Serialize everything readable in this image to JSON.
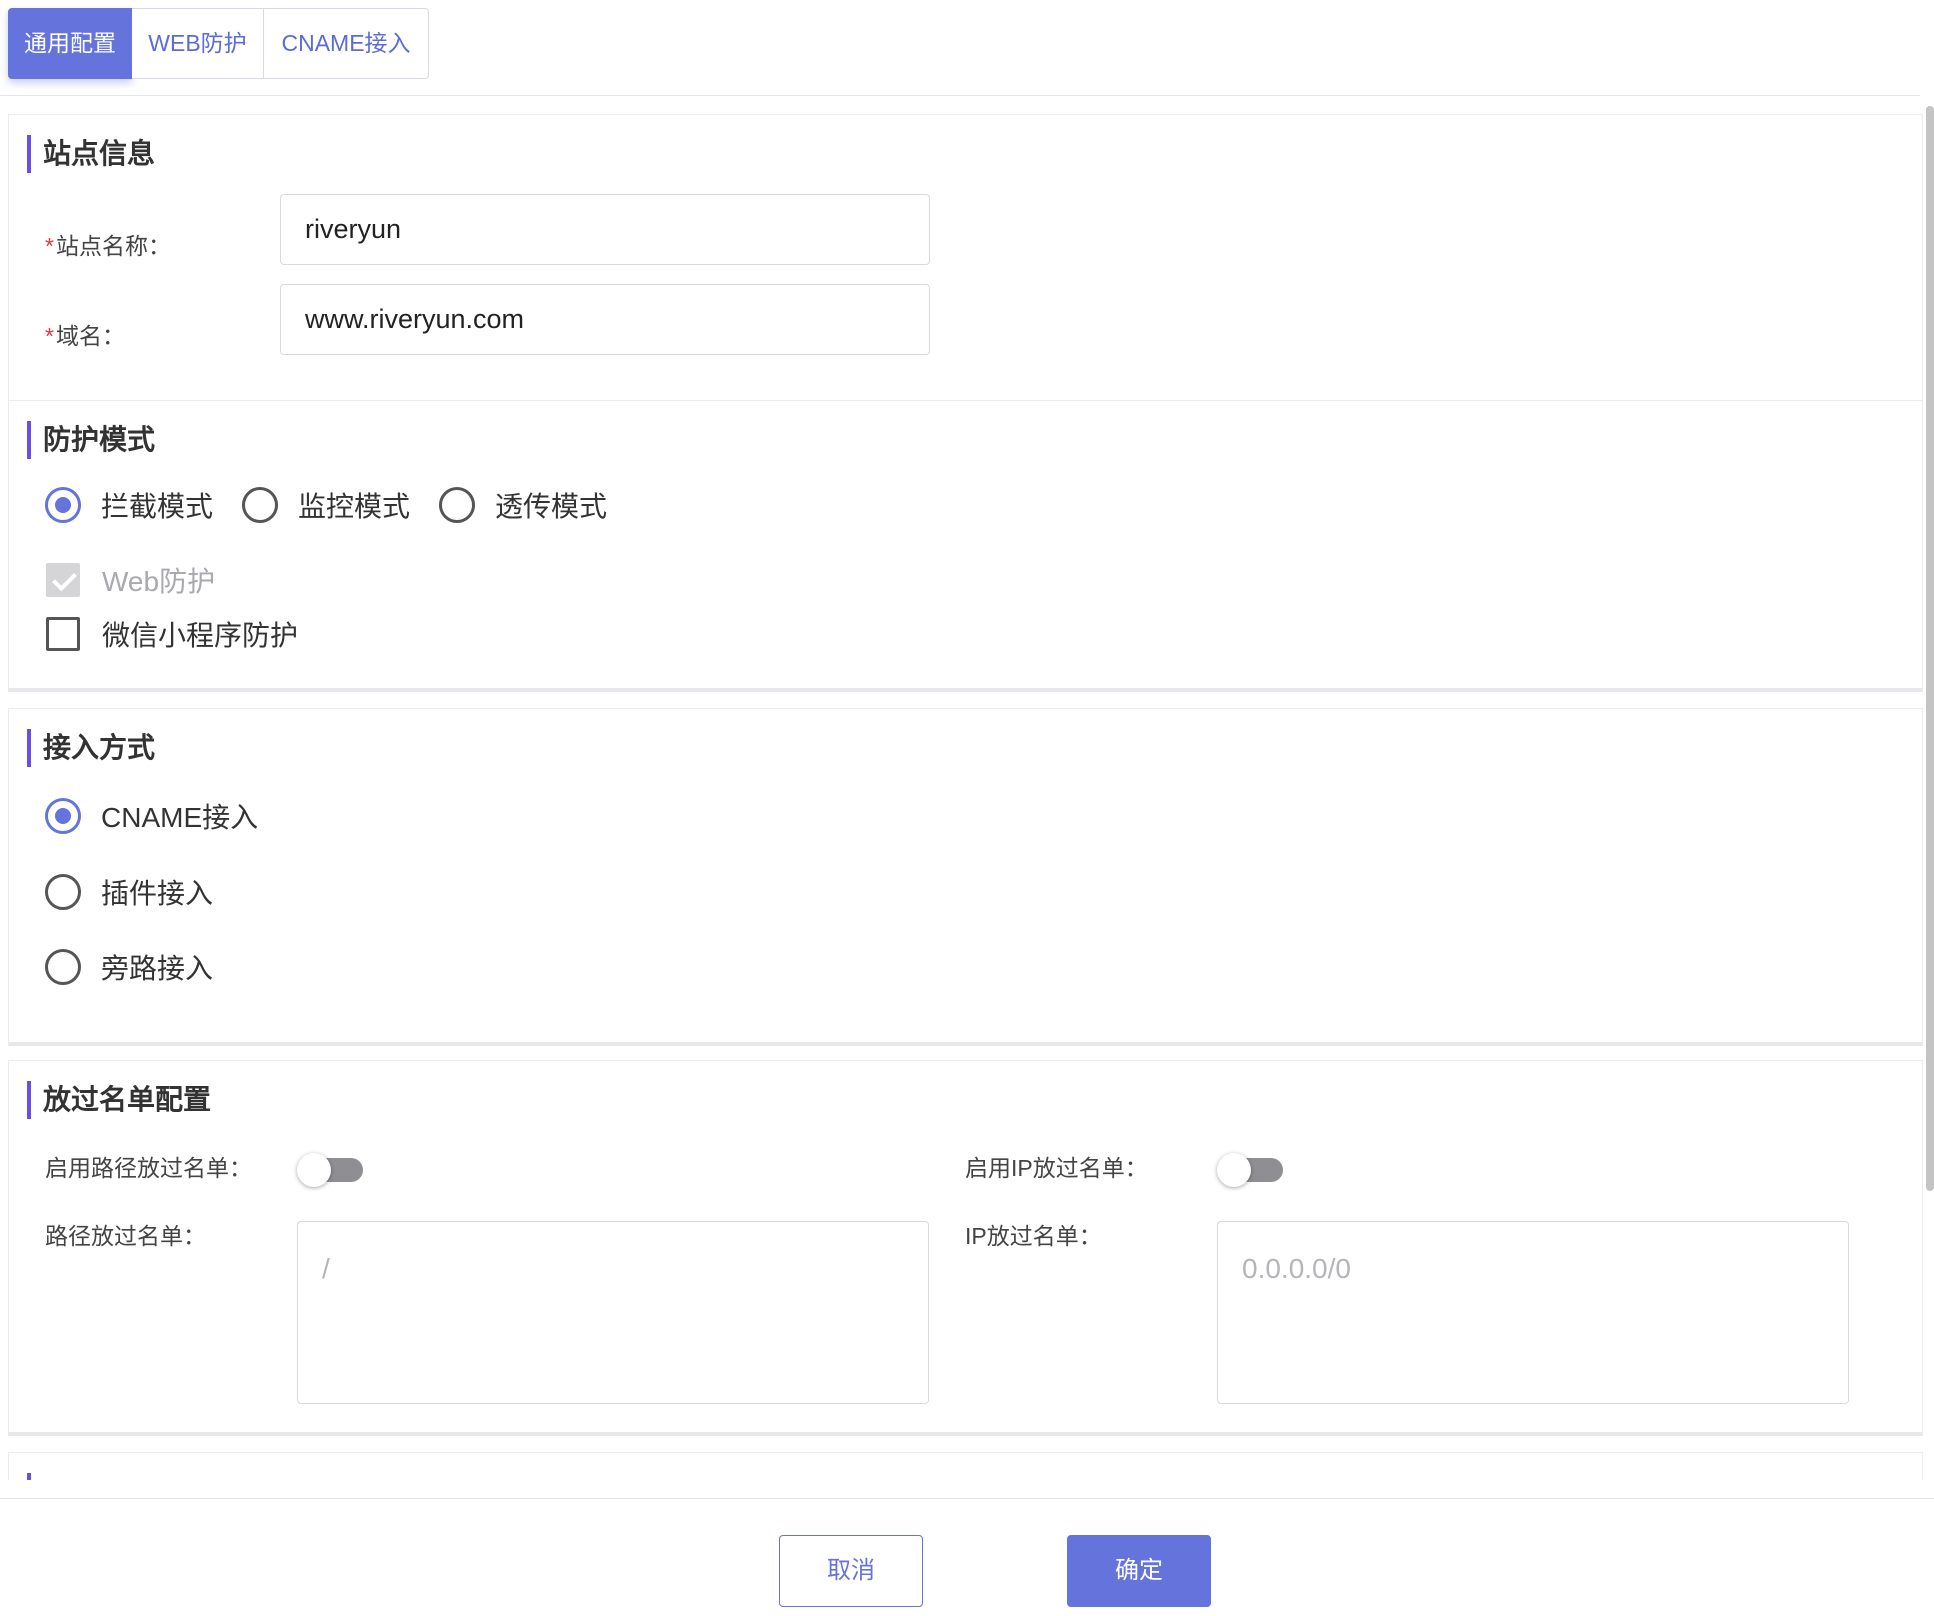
{
  "tabs": [
    {
      "label": "通用配置",
      "active": true
    },
    {
      "label": "WEB防护",
      "active": false
    },
    {
      "label": "CNAME接入",
      "active": false
    }
  ],
  "site_info": {
    "title": "站点信息",
    "name_label": "站点名称：",
    "name_value": "riveryun",
    "domain_label": "域名：",
    "domain_value": "www.riveryun.com",
    "required_mark": "*"
  },
  "protection": {
    "title": "防护模式",
    "modes": [
      {
        "label": "拦截模式",
        "checked": true
      },
      {
        "label": "监控模式",
        "checked": false
      },
      {
        "label": "透传模式",
        "checked": false
      }
    ],
    "options": [
      {
        "label": "Web防护",
        "checked": true,
        "disabled": true
      },
      {
        "label": "微信小程序防护",
        "checked": false,
        "disabled": false
      }
    ]
  },
  "access": {
    "title": "接入方式",
    "methods": [
      {
        "label": "CNAME接入",
        "checked": true
      },
      {
        "label": "插件接入",
        "checked": false
      },
      {
        "label": "旁路接入",
        "checked": false
      }
    ]
  },
  "whitelist": {
    "title": "放过名单配置",
    "path_toggle_label": "启用路径放过名单：",
    "path_toggle_on": false,
    "ip_toggle_label": "启用IP放过名单：",
    "ip_toggle_on": false,
    "path_list_label": "路径放过名单：",
    "path_list_placeholder": "/",
    "ip_list_label": "IP放过名单：",
    "ip_list_placeholder": "0.0.0.0/0"
  },
  "footer": {
    "cancel_label": "取消",
    "ok_label": "确定"
  },
  "colors": {
    "accent": "#6474dc",
    "title_bar": "#6a4ee6",
    "required": "#e0393e"
  }
}
